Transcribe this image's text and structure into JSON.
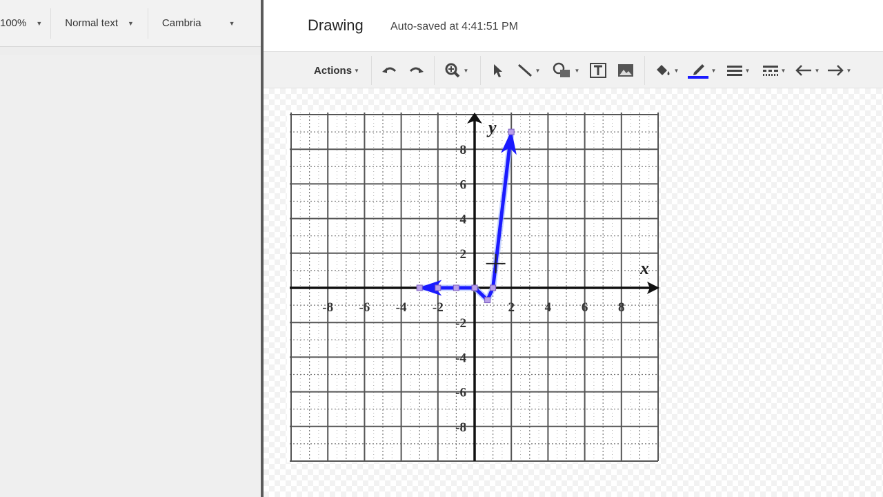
{
  "docs_toolbar": {
    "zoom": "100%",
    "style": "Normal text",
    "font": "Cambria"
  },
  "dialog": {
    "title": "Drawing",
    "autosave": "Auto-saved at 4:41:51 PM"
  },
  "toolbar": {
    "actions_label": "Actions",
    "icons": [
      "undo-icon",
      "redo-icon",
      "zoom-icon",
      "select-icon",
      "line-icon",
      "shape-icon",
      "textbox-icon",
      "image-icon",
      "fill-color-icon",
      "line-color-icon",
      "line-weight-icon",
      "line-dash-icon",
      "line-start-icon",
      "line-end-icon"
    ],
    "line_color": "#1a1aff"
  },
  "chart_data": {
    "type": "line",
    "xlabel": "x",
    "ylabel": "y",
    "xlim": [
      -9.5,
      9.5
    ],
    "ylim": [
      -10,
      10
    ],
    "x_ticks": [
      -8,
      -6,
      -4,
      -2,
      2,
      4,
      6,
      8
    ],
    "x_tick_labels": [
      "-8",
      "-6",
      "-4",
      "-2",
      "2",
      "4",
      "6",
      "8"
    ],
    "y_ticks": [
      8,
      6,
      4,
      2,
      -2,
      -4,
      -6,
      -8
    ],
    "y_tick_labels": [
      "8",
      "6",
      "4",
      "2",
      "-2",
      "-4",
      "-6",
      "-8"
    ],
    "grid": true,
    "series": [
      {
        "color": "#1a1aff",
        "points": [
          [
            -3,
            0
          ],
          [
            -2,
            0
          ],
          [
            -1,
            0
          ],
          [
            0,
            0
          ],
          [
            0.7,
            -0.7
          ],
          [
            1,
            0
          ],
          [
            2,
            9
          ]
        ],
        "arrow_start": true,
        "arrow_end": true
      }
    ]
  }
}
